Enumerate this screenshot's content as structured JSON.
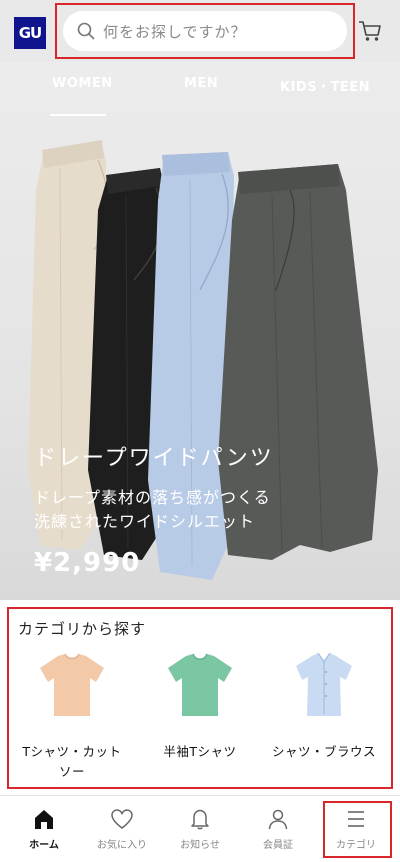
{
  "header": {
    "logo_text": "GU",
    "search_placeholder": "何をお探しですか？",
    "search_icon": "search-icon",
    "cart_icon": "cart-icon"
  },
  "tabs": [
    {
      "label": "WOMEN",
      "active": true
    },
    {
      "label": "MEN",
      "active": false
    },
    {
      "label": "KIDS・TEEN",
      "active": false
    }
  ],
  "hero": {
    "title": "ドレープワイドパンツ",
    "subtitle_line1": "ドレープ素材の落ち感がつくる",
    "subtitle_line2": "洗練されたワイドシルエット",
    "price": "¥2,990",
    "pant_colors": [
      "#e6dccb",
      "#1e1e1e",
      "#b7cbe6",
      "#575a57"
    ]
  },
  "categories": {
    "title": "カテゴリから探す",
    "items": [
      {
        "label_line1": "Tシャツ・カット",
        "label_line2": "ソー",
        "icon": "tshirt-icon",
        "color": "#f4c9a8"
      },
      {
        "label_line1": "半袖Tシャツ",
        "label_line2": "",
        "icon": "tshirt-icon",
        "color": "#7cc7a3"
      },
      {
        "label_line1": "シャツ・ブラウス",
        "label_line2": "",
        "icon": "shirt-icon",
        "color": "#c8dbf3"
      }
    ]
  },
  "bottom_nav": [
    {
      "label": "ホーム",
      "icon": "home-icon",
      "active": true
    },
    {
      "label": "お気に入り",
      "icon": "heart-icon",
      "active": false
    },
    {
      "label": "お知らせ",
      "icon": "bell-icon",
      "active": false
    },
    {
      "label": "会員証",
      "icon": "user-icon",
      "active": false
    },
    {
      "label": "カテゴリ",
      "icon": "menu-icon",
      "active": false
    }
  ]
}
